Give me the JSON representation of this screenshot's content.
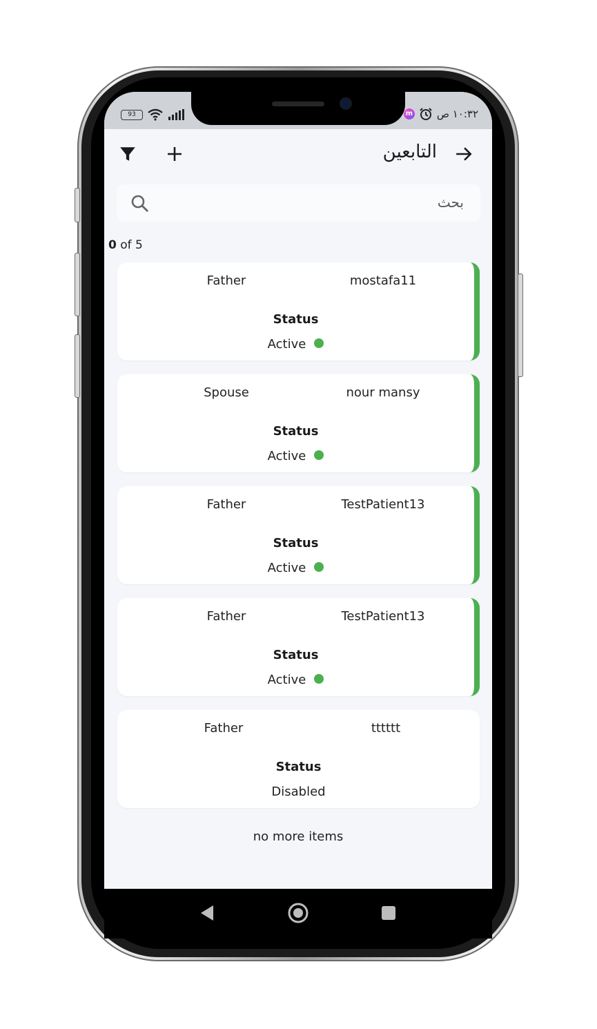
{
  "status_bar": {
    "battery": "93",
    "time": "١٠:٣٢ ص"
  },
  "header": {
    "title": "التابعين",
    "back_icon": "arrow-right-icon",
    "add_icon": "plus-icon",
    "filter_icon": "filter-icon"
  },
  "search": {
    "placeholder": "بحث"
  },
  "count": {
    "current": "0",
    "of_label": "of 5"
  },
  "cards": [
    {
      "relation": "Father",
      "name": "mostafa11",
      "status_label": "Status",
      "status": "Active",
      "active": true
    },
    {
      "relation": "Spouse",
      "name": "nour mansy",
      "status_label": "Status",
      "status": "Active",
      "active": true
    },
    {
      "relation": "Father",
      "name": "TestPatient13",
      "status_label": "Status",
      "status": "Active",
      "active": true
    },
    {
      "relation": "Father",
      "name": "TestPatient13",
      "status_label": "Status",
      "status": "Active",
      "active": true
    },
    {
      "relation": "Father",
      "name": "tttttt",
      "status_label": "Status",
      "status": "Disabled",
      "active": false
    }
  ],
  "footer": "no more items",
  "colors": {
    "accent_active": "#4caf50",
    "background": "#f4f6fa"
  }
}
